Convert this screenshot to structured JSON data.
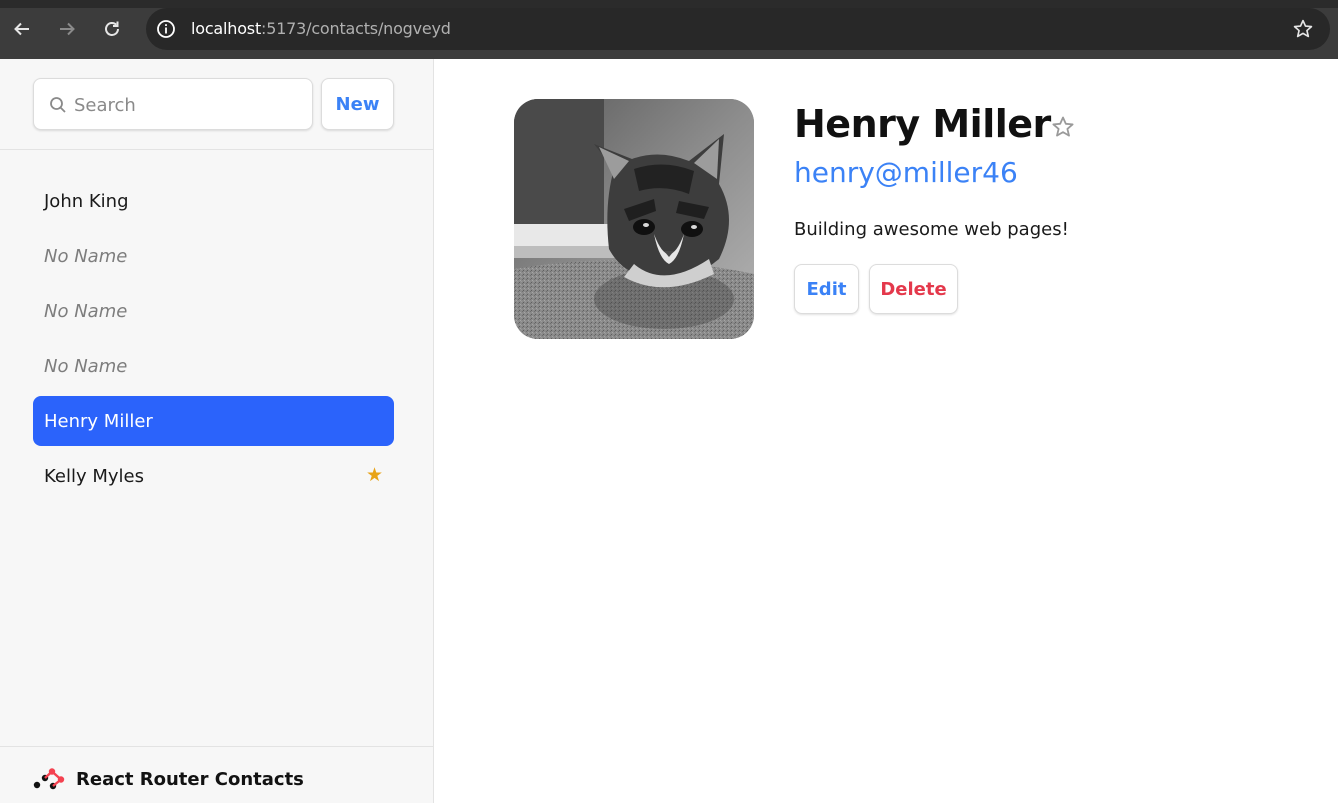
{
  "browser": {
    "url_host": "localhost",
    "url_path": ":5173/contacts/nogveyd",
    "icons": {
      "back": "back-arrow-icon",
      "forward": "forward-arrow-icon",
      "reload": "reload-icon",
      "info": "info-icon",
      "bookmark": "star-outline-icon"
    }
  },
  "sidebar": {
    "search_placeholder": "Search",
    "new_label": "New",
    "contacts": [
      {
        "label": "John King",
        "style": "normal",
        "favorite": false
      },
      {
        "label": "No Name",
        "style": "noname",
        "favorite": false
      },
      {
        "label": "No Name",
        "style": "noname",
        "favorite": false
      },
      {
        "label": "No Name",
        "style": "noname",
        "favorite": false
      },
      {
        "label": "Henry Miller",
        "style": "active",
        "favorite": false
      },
      {
        "label": "Kelly Myles",
        "style": "normal",
        "favorite": true,
        "favorite_glyph": "★"
      }
    ],
    "brand": "React Router Contacts"
  },
  "contact": {
    "name": "Henry Miller",
    "favorite_glyph": "☆",
    "handle": "henry@miller46",
    "notes": "Building awesome web pages!",
    "edit_label": "Edit",
    "delete_label": "Delete"
  },
  "colors": {
    "accent": "#2b63fb",
    "link": "#3b82f6",
    "danger": "#e4384b",
    "favorite": "#e8a317",
    "sidebar_bg": "#f7f7f7"
  }
}
